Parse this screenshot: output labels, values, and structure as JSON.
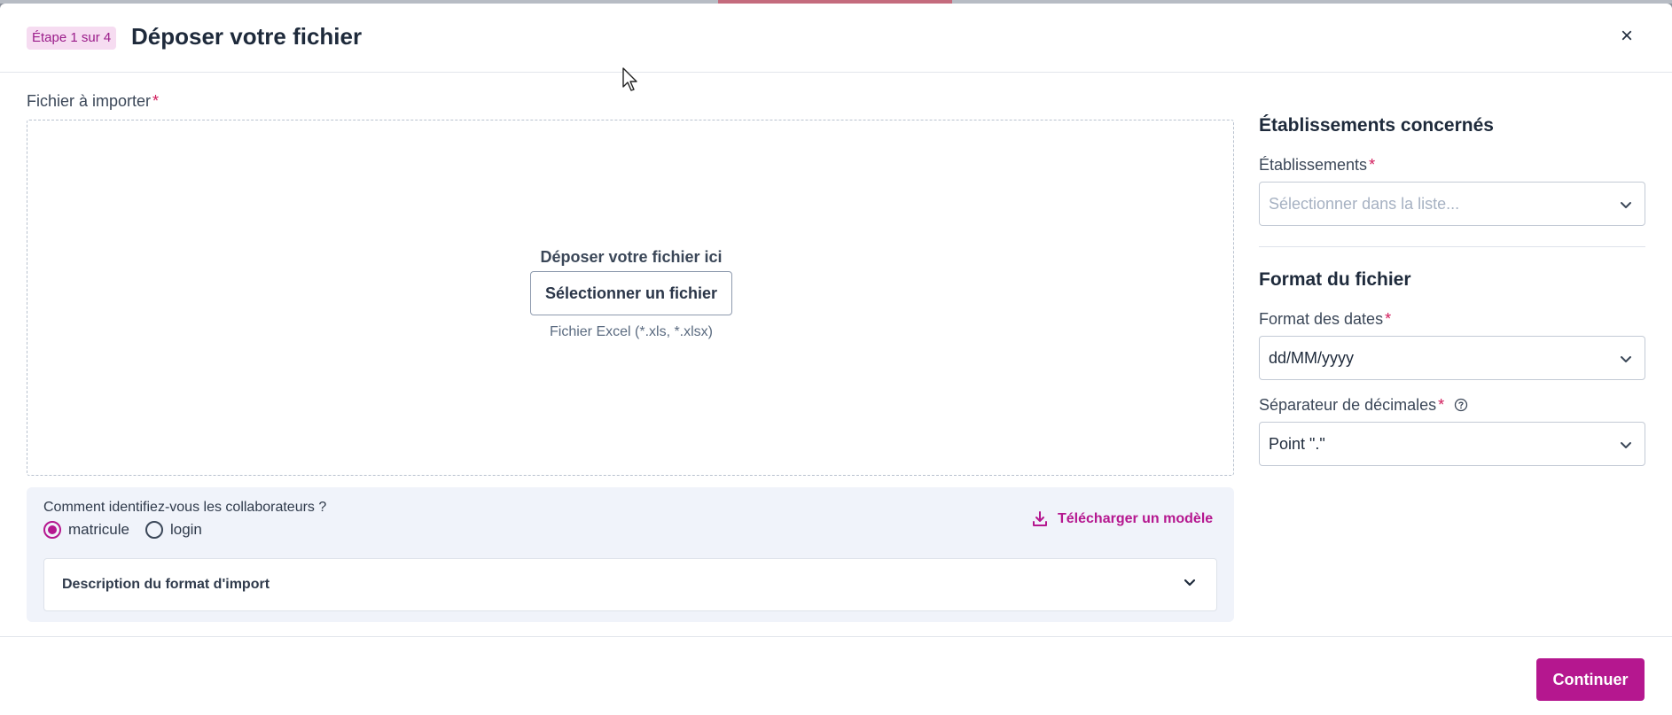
{
  "header": {
    "step_badge": "Étape 1 sur 4",
    "title": "Déposer votre fichier",
    "close_label": "×"
  },
  "file_upload": {
    "label": "Fichier à importer",
    "required_mark": "*",
    "drop_text": "Déposer votre fichier ici",
    "select_button": "Sélectionner un fichier",
    "hint": "Fichier Excel (*.xls, *.xlsx)"
  },
  "identify": {
    "question": "Comment identifiez-vous les collaborateurs ?",
    "options": [
      {
        "label": "matricule",
        "checked": true
      },
      {
        "label": "login",
        "checked": false
      }
    ],
    "download_link": "Télécharger un modèle",
    "description_title": "Description du format d'import"
  },
  "establishments": {
    "section_title": "Établissements concernés",
    "field_label": "Établissements",
    "required_mark": "*",
    "placeholder": "Sélectionner dans la liste..."
  },
  "file_format": {
    "section_title": "Format du fichier",
    "date_label": "Format des dates",
    "date_value": "dd/MM/yyyy",
    "decimal_label": "Séparateur de décimales",
    "decimal_value": "Point \".\"",
    "required_mark": "*"
  },
  "footer": {
    "continue_button": "Continuer"
  },
  "colors": {
    "accent": "#b5178f",
    "required": "#d11a5a",
    "badge_bg": "#f6dcf1"
  },
  "icons": [
    "close-icon",
    "download-icon",
    "chevron-down-icon",
    "help-icon",
    "mouse-cursor-icon"
  ]
}
